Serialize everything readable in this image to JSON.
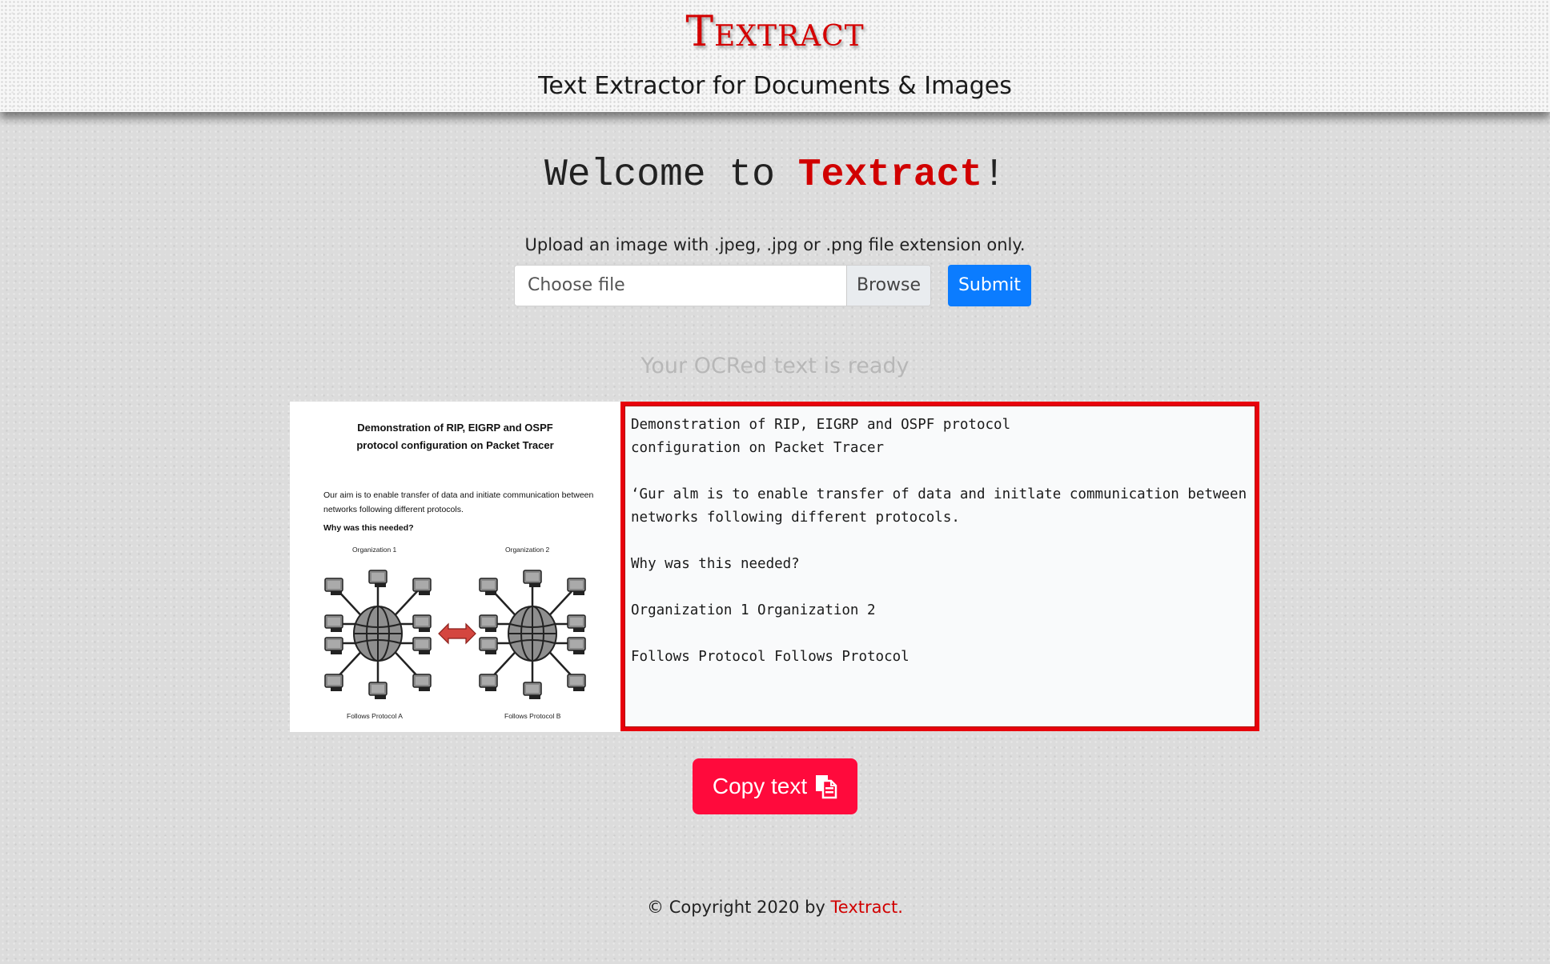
{
  "header": {
    "brand": "Textract",
    "tagline": "Text Extractor for Documents & Images"
  },
  "welcome": {
    "prefix": "Welcome to ",
    "brand": "Textract",
    "suffix": "!"
  },
  "upload": {
    "hint": "Upload an image with .jpeg, .jpg or .png file extension only.",
    "file_placeholder": "Choose file",
    "browse_label": "Browse",
    "submit_label": "Submit"
  },
  "result": {
    "heading": "Your OCRed text is ready",
    "ocr_text": "Demonstration of RIP, EIGRP and OSPF protocol\nconfiguration on Packet Tracer\n\n‘Gur alm is to enable transfer of data and initlate communication between\nnetworks following different protocols.\n\nWhy was this needed?\n\nOrganization 1 Organization 2\n\nFollows Protocol Follows Protocol",
    "copy_label": "Copy text"
  },
  "preview": {
    "title": "Demonstration of RIP, EIGRP and OSPF protocol configuration on Packet Tracer",
    "aim": "Our aim is to enable transfer of data and initiate communication between networks following different protocols.",
    "why": "Why was this needed?",
    "org1": "Organization 1",
    "org2": "Organization 2",
    "protocol_a": "Follows Protocol A",
    "protocol_b": "Follows Protocol B"
  },
  "footer": {
    "prefix": "© Copyright 2020 by ",
    "brand": "Textract."
  },
  "colors": {
    "brand_red": "#d10000",
    "submit_blue": "#0b7cff",
    "copy_button": "#ff0a3c",
    "ocr_border": "#e8000b"
  },
  "icons": {
    "copy": "copy-icon"
  }
}
